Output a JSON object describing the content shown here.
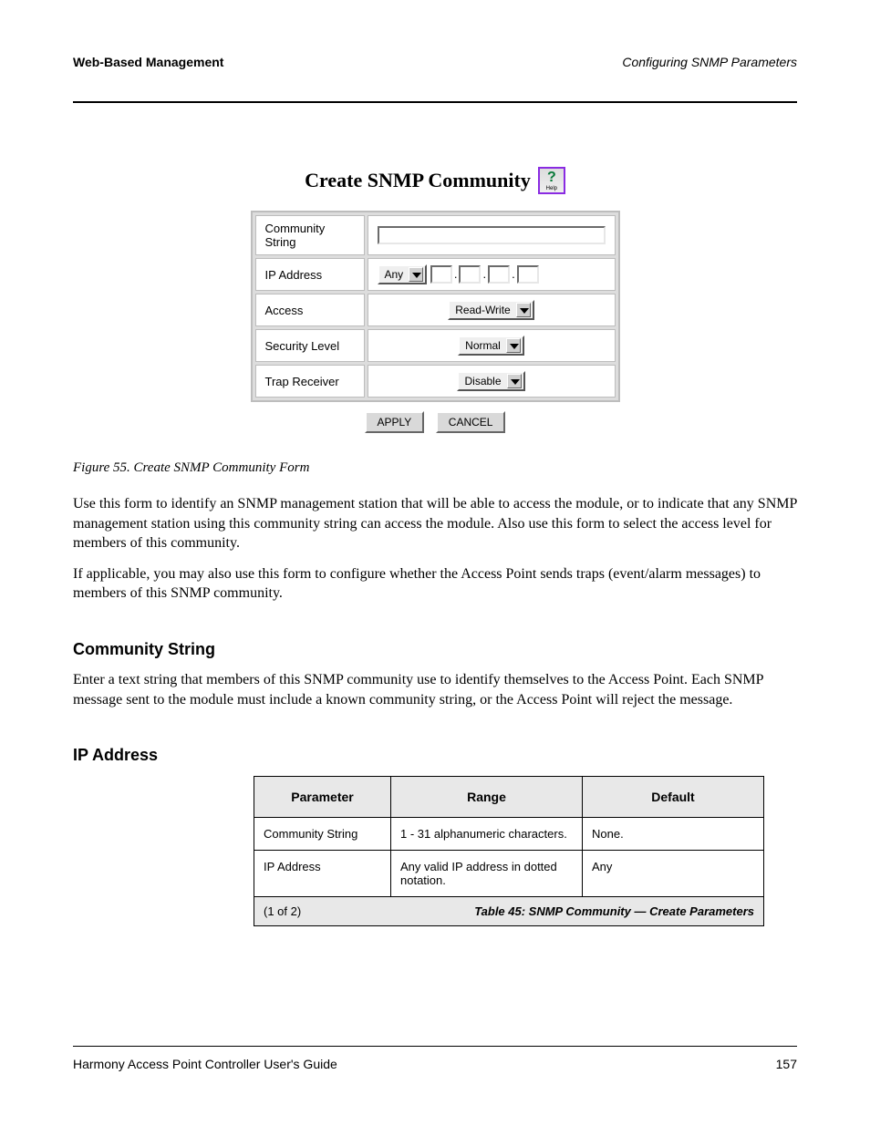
{
  "header": {
    "left_bold": "Web-Based Management",
    "right_italic": "Configuring SNMP Parameters"
  },
  "figure": {
    "title": "Create SNMP Community",
    "help_label": "Help",
    "form": {
      "community_string": {
        "label": "Community String",
        "value": ""
      },
      "ip_address": {
        "label": "IP Address",
        "select": "Any",
        "o1": "",
        "o2": "",
        "o3": "",
        "o4": ""
      },
      "access": {
        "label": "Access",
        "value": "Read-Write"
      },
      "security_level": {
        "label": "Security Level",
        "value": "Normal"
      },
      "trap_receiver": {
        "label": "Trap Receiver",
        "value": "Disable"
      }
    },
    "buttons": {
      "apply": "APPLY",
      "cancel": "CANCEL"
    }
  },
  "caption": "Figure 55.   Create SNMP Community Form",
  "body": {
    "p1": "Use this form to identify an SNMP management station that will be able to access the module, or to indicate that any SNMP management station using this community string can access the module. Also use this form to select the access level for members of this community.",
    "p2": "If applicable, you may also use this form to configure whether the Access Point sends traps (event/alarm messages) to members of this SNMP community.",
    "h1": "Community String",
    "p3": "Enter a text string that members of this SNMP community use to identify themselves to the Access Point. Each SNMP message sent to the module must include a known community string, or the Access Point will reject the message.",
    "h2": "IP Address"
  },
  "table": {
    "headers": [
      "Parameter",
      "Range",
      "Default"
    ],
    "rows": [
      [
        "Community String",
        "1 - 31 alphanumeric characters.",
        "None."
      ],
      [
        "IP Address",
        "Any valid IP address in dotted notation.",
        "Any"
      ]
    ],
    "footer_left": "(1 of 2)",
    "footer_right": "Table 45:   SNMP Community — Create Parameters"
  },
  "footer": {
    "left": "Harmony Access Point Controller User's Guide",
    "right": "157"
  }
}
